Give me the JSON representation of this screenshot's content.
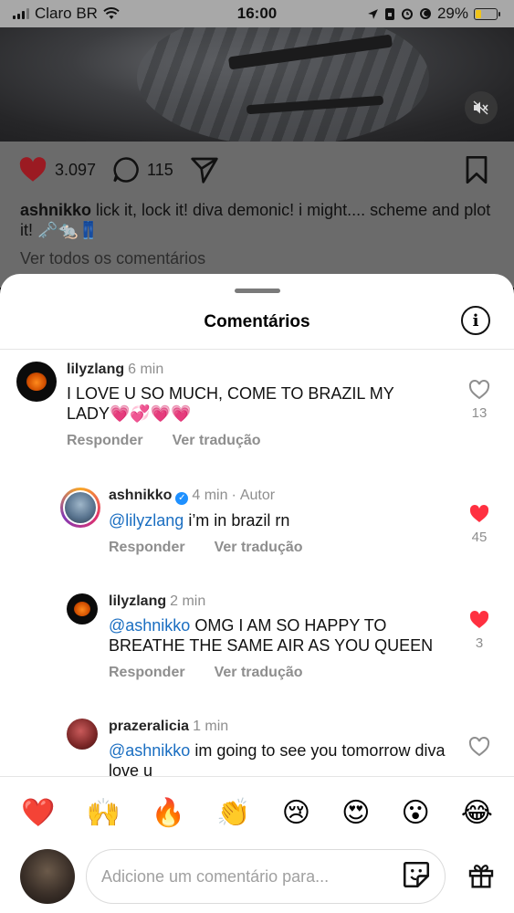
{
  "status": {
    "carrier": "Claro BR",
    "time": "16:00",
    "battery": "29%"
  },
  "post": {
    "likes": "3.097",
    "comments_count": "115",
    "caption_user": "ashnikko",
    "caption_text": "lick it, lock it! diva demonic! i might.... scheme and plot it! 🗝️🐀👖",
    "see_all": "Ver todos os comentários"
  },
  "sheet": {
    "title": "Comentários"
  },
  "comments": [
    {
      "username": "lilyzlang",
      "time": "6 min",
      "text": "I LOVE U SO MUCH, COME TO BRAZIL MY LADY💗💞💗💗",
      "reply": "Responder",
      "translate": "Ver tradução",
      "likes": "13",
      "liked": false
    },
    {
      "username": "ashnikko",
      "time": "4 min",
      "author": "Autor",
      "mention": "@lilyzlang",
      "text": " i’m in brazil rn",
      "reply": "Responder",
      "translate": "Ver tradução",
      "likes": "45",
      "liked": true
    },
    {
      "username": "lilyzlang",
      "time": "2 min",
      "mention": "@ashnikko",
      "text": " OMG I AM SO HAPPY TO BREATHE THE SAME AIR AS YOU QUEEN",
      "reply": "Responder",
      "translate": "Ver tradução",
      "likes": "3",
      "liked": true
    },
    {
      "username": "prazeralicia",
      "time": "1 min",
      "mention": "@ashnikko",
      "text": " im going to see you tomorrow diva love u",
      "liked": false
    }
  ],
  "emojis": [
    "❤️",
    "🙌",
    "🔥",
    "👏",
    "😢",
    "😍",
    "😮",
    "😂"
  ],
  "composer": {
    "placeholder": "Adicione um comentário para..."
  },
  "colors": {
    "like_red": "#ff3040",
    "mention_blue": "#1a6ec1"
  }
}
